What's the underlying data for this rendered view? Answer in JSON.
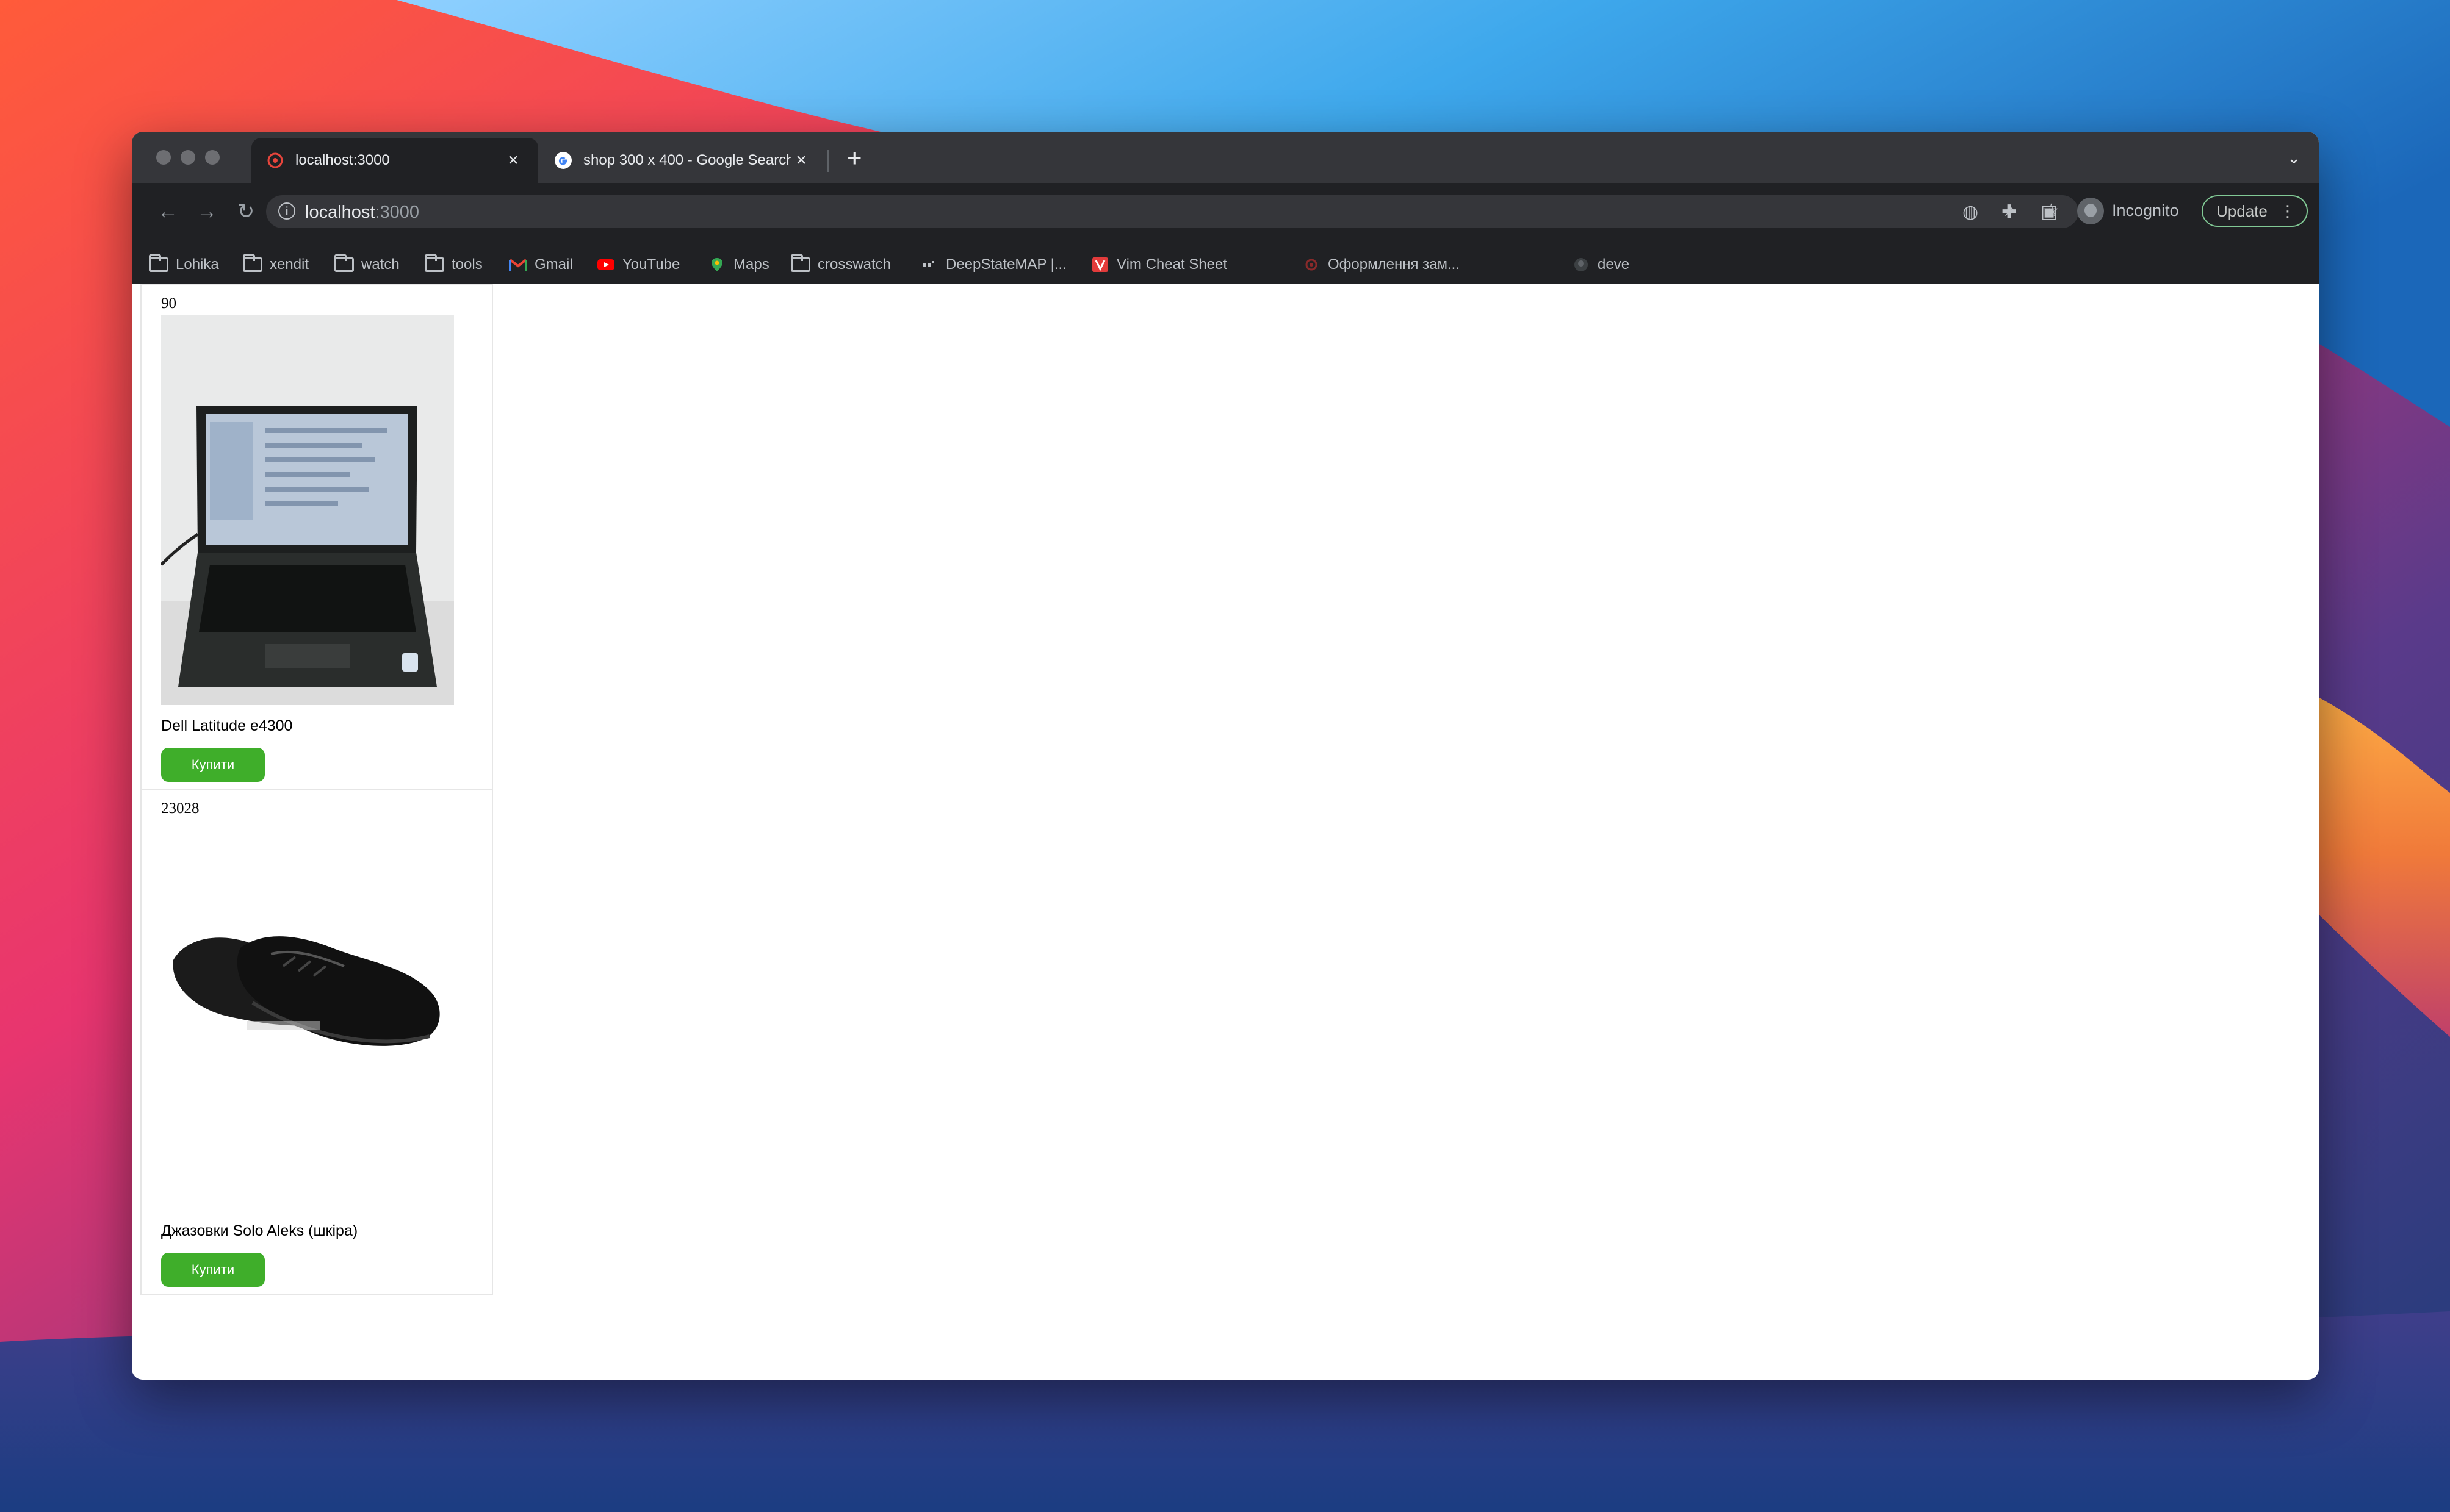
{
  "window": {
    "tabs": [
      {
        "title": "localhost:3000",
        "active": true
      },
      {
        "title": "shop 300 x 400 - Google Search",
        "active": false
      }
    ]
  },
  "toolbar": {
    "url_host": "localhost",
    "url_port": ":3000",
    "profile_label": "Incognito",
    "update_label": "Update"
  },
  "bookmarks": [
    {
      "label": "Lohika",
      "icon": "folder-icon"
    },
    {
      "label": "xendit",
      "icon": "folder-icon"
    },
    {
      "label": "watch",
      "icon": "folder-icon"
    },
    {
      "label": "tools",
      "icon": "folder-icon"
    },
    {
      "label": "Gmail",
      "icon": "gmail-icon"
    },
    {
      "label": "YouTube",
      "icon": "youtube-icon"
    },
    {
      "label": "Maps",
      "icon": "maps-icon"
    },
    {
      "label": "crosswatch",
      "icon": "folder-icon"
    },
    {
      "label": "DeepStateMAP |...",
      "icon": "deepstate-icon"
    },
    {
      "label": "Vim Cheat Sheet",
      "icon": "vim-icon"
    },
    {
      "label": "Оформлення зам...",
      "icon": "order-icon"
    },
    {
      "label": "deve",
      "icon": "github-icon"
    }
  ],
  "products": [
    {
      "price": "90",
      "name": "Dell Latitude e4300",
      "button": "Купити",
      "image": "laptop"
    },
    {
      "price": "23028",
      "name": "Джазовки Solo Aleks (шкіра)",
      "button": "Купити",
      "image": "shoes"
    }
  ],
  "colors": {
    "accent_button": "#3fae2a",
    "browser_frame": "#202124",
    "tabstrip": "#35363a"
  }
}
